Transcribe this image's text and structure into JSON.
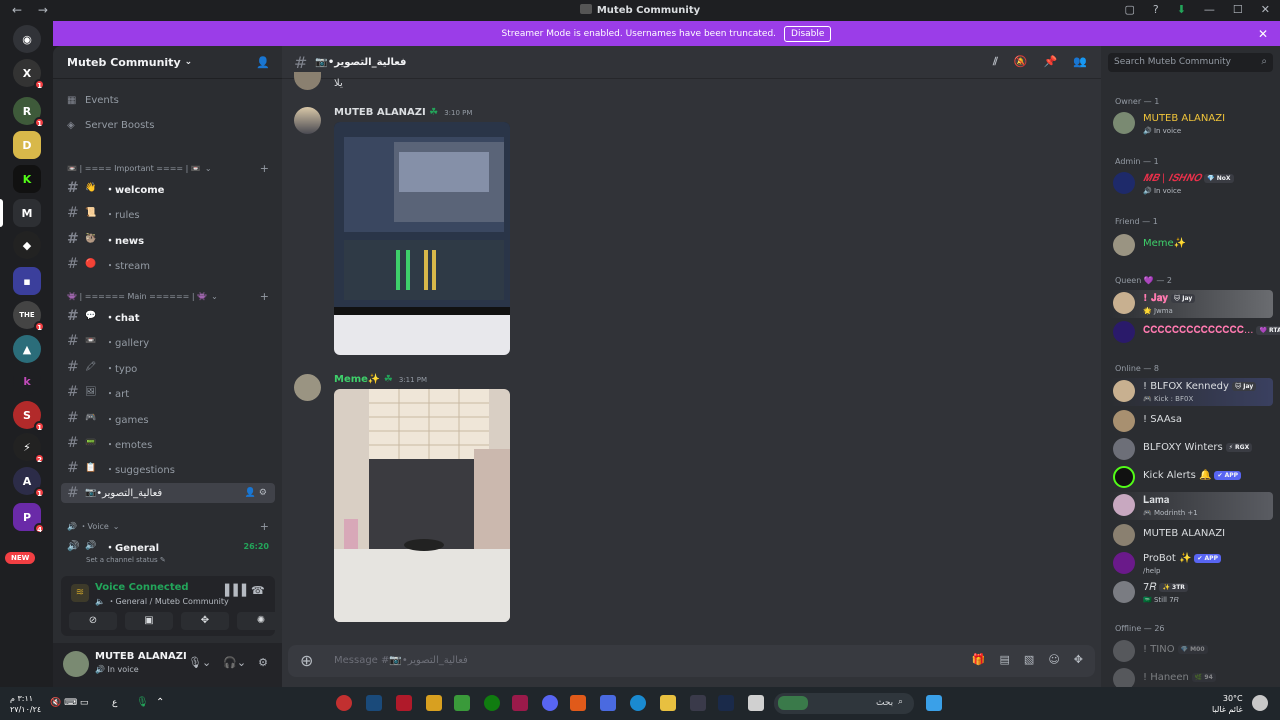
{
  "window": {
    "title": "Muteb Community",
    "controls": [
      "▢",
      "?",
      "⬇",
      "—",
      "☐",
      "✕"
    ]
  },
  "banner": {
    "text": "Streamer Mode is enabled. Usernames have been truncated.",
    "button": "Disable"
  },
  "server": {
    "name": "Muteb Community"
  },
  "sidebar": {
    "top_items": [
      {
        "label": "Events"
      },
      {
        "label": "Server Boosts"
      }
    ],
    "categories": [
      {
        "label": "📼 | ==== Important ==== | 📼"
      },
      {
        "label": "👾 | ====== Main ====== | 👾"
      },
      {
        "label": "🔊 ・Voice"
      }
    ],
    "channels": [
      {
        "emoji": "👋",
        "label": "・welcome"
      },
      {
        "emoji": "📜",
        "label": "・rules"
      },
      {
        "emoji": "🦥",
        "label": "・news"
      },
      {
        "emoji": "🔴",
        "label": "・stream"
      },
      {
        "emoji": "💬",
        "label": "・chat"
      },
      {
        "emoji": "📼",
        "label": "・gallery"
      },
      {
        "emoji": "🖍",
        "label": "・typo"
      },
      {
        "emoji": "🖼",
        "label": "・art"
      },
      {
        "emoji": "🎮",
        "label": "・games"
      },
      {
        "emoji": "📟",
        "label": "・emotes"
      },
      {
        "emoji": "📋",
        "label": "・suggestions"
      },
      {
        "emoji": "📷",
        "label": "•فعالية_التصوير"
      }
    ],
    "voice": {
      "name": "・General",
      "timer": "26:20",
      "status": "Set a channel status ✎"
    },
    "voice_connected": {
      "title": "Voice Connected",
      "subtitle": "・General / Muteb Community"
    },
    "user": {
      "name": "MUTEB ALANAZI",
      "status": "In voice"
    }
  },
  "chat": {
    "channel_name": "📷•فعالية_التصوير",
    "prev_message": "يلا",
    "messages": [
      {
        "author": "MUTEB ALANAZI",
        "time": "3:10 PM"
      },
      {
        "author": "Meme✨",
        "time": "3:11 PM"
      }
    ],
    "composer_placeholder": "Message #📷•فعالية_التصوير"
  },
  "members": {
    "search_placeholder": "Search Muteb Community",
    "groups": [
      "Owner — 1",
      "Admin — 1",
      "Friend — 1",
      "Queen 💜 — 2",
      "Online — 8",
      "Offline — 26"
    ],
    "list": [
      {
        "name": "MUTEB ALANAZI",
        "sub": "🔊 In voice",
        "color": "#f0c43a"
      },
      {
        "name": "𝑴𝑩 | 𝑰𝑺𝑯𝑵𝑶",
        "tag": "💎 NoX",
        "sub": "🔊 In voice",
        "color": "#e8304a"
      },
      {
        "name": "Meme✨",
        "color": "#3ecf6a"
      },
      {
        "name": "! 𝐉𝐚𝐲",
        "tag": "🐱 Jay",
        "sub": "🌟 Jwma",
        "color": "#ff7ab0"
      },
      {
        "name": "𝐂𝐂𝐂𝐂𝐂𝐂𝐂𝐂𝐂𝐂𝐂𝐂𝐂𝐂...",
        "tag": "💜 RTA",
        "color": "#ff7ab0"
      },
      {
        "name": "! BLFOX Kennedy",
        "tag": "🐱 Jay",
        "sub": "🎮 Kick : BF0X",
        "color": "#dbdee1"
      },
      {
        "name": "! SAAsa",
        "color": "#dbdee1"
      },
      {
        "name": "BLFOXY Winters",
        "tag": "⚡ RGX",
        "color": "#dbdee1"
      },
      {
        "name": "Kick Alerts 🔔",
        "tag": "✔ APP",
        "color": "#dbdee1"
      },
      {
        "name": "𝐋𝐚𝐦𝐚",
        "sub": "🎮 Modrinth +1",
        "color": "#dbdee1"
      },
      {
        "name": "MUTEB ALANAZI",
        "color": "#dbdee1"
      },
      {
        "name": "ProBot ✨",
        "tag": "✔ APP",
        "sub": "/help",
        "color": "#dbdee1"
      },
      {
        "name": "7𝑅",
        "tag": "✨ 3TR",
        "sub": "🇸🇦 Still 7𝑅",
        "color": "#dbdee1"
      },
      {
        "name": "! TINO",
        "tag": "💎 M00",
        "color": "#6d6f78"
      },
      {
        "name": "! Haneen",
        "tag": "🌿 94",
        "color": "#6d6f78"
      }
    ]
  },
  "guild_badges": [
    "1",
    "1",
    "1",
    "1",
    "1",
    "2",
    "1",
    "4"
  ],
  "guild_new": "NEW",
  "taskbar": {
    "search_placeholder": "بحث",
    "weather_temp": "30°C",
    "weather_desc": "غائم غالبا",
    "time": "٣:١١ م",
    "date": "٢٧/١٠/٢٤",
    "lang": "ع"
  }
}
